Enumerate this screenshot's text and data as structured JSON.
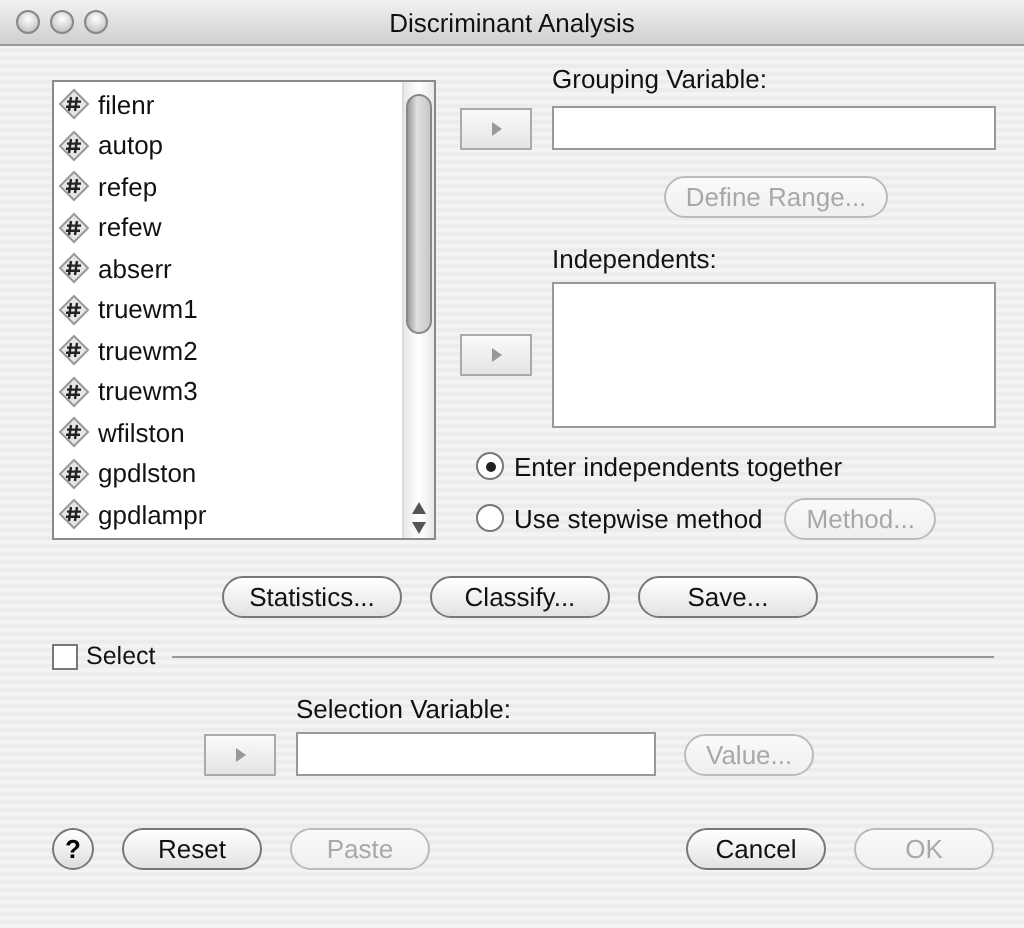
{
  "window": {
    "title": "Discriminant Analysis"
  },
  "variables": [
    {
      "name": "filenr"
    },
    {
      "name": "autop"
    },
    {
      "name": "refep"
    },
    {
      "name": "refew"
    },
    {
      "name": "abserr"
    },
    {
      "name": "truewm1"
    },
    {
      "name": "truewm2"
    },
    {
      "name": "truewm3"
    },
    {
      "name": "wfilston"
    },
    {
      "name": "gpdlston"
    },
    {
      "name": "gpdlampr"
    }
  ],
  "grouping_variable": {
    "label": "Grouping Variable:"
  },
  "define_range_button": {
    "label": "Define Range...",
    "disabled": true
  },
  "independents": {
    "label": "Independents:"
  },
  "methods": [
    {
      "label": "Enter independents together",
      "selected": true
    },
    {
      "label": "Use stepwise method",
      "selected": false
    }
  ],
  "method_button": {
    "label": "Method...",
    "disabled": true
  },
  "option_buttons": [
    {
      "label": "Statistics...",
      "disabled": false
    },
    {
      "label": "Classify...",
      "disabled": false
    },
    {
      "label": "Save...",
      "disabled": false
    }
  ],
  "select": {
    "label": "Select",
    "checked": false,
    "variable_label": "Selection Variable:",
    "value_button": {
      "label": "Value...",
      "disabled": true
    }
  },
  "help": "?",
  "footer_buttons": [
    {
      "label": "Reset",
      "disabled": false
    },
    {
      "label": "Paste",
      "disabled": true
    },
    {
      "label": "Cancel",
      "disabled": false
    },
    {
      "label": "OK",
      "disabled": true
    }
  ]
}
